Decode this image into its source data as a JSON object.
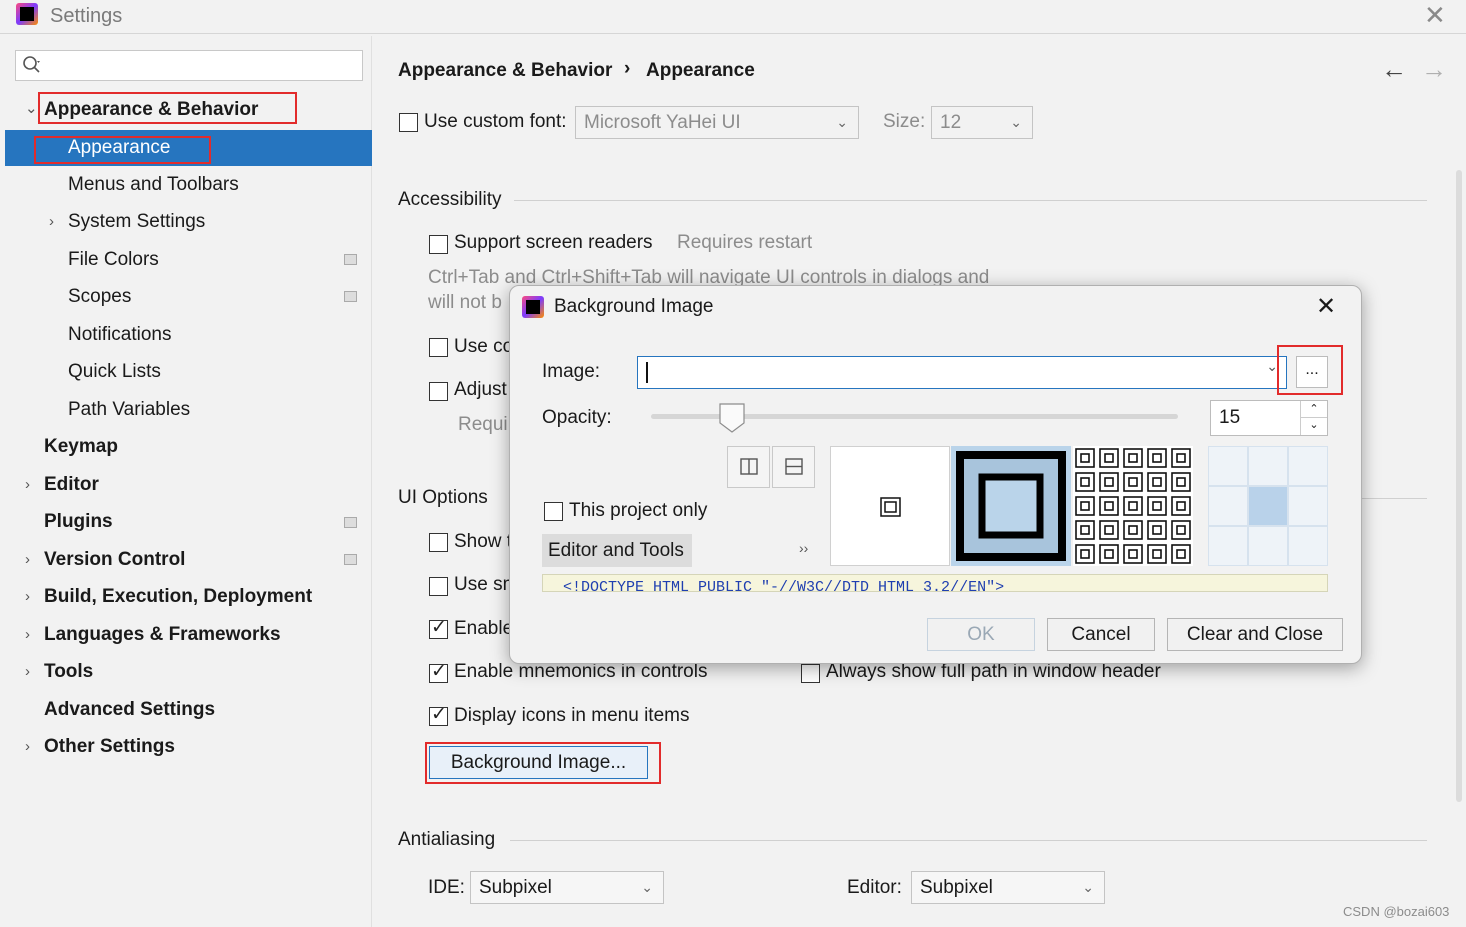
{
  "window": {
    "title": "Settings",
    "close_icon": "close-icon"
  },
  "sidebar": {
    "search_placeholder": "",
    "items": [
      {
        "label": "Appearance & Behavior",
        "level": 0,
        "expanded": true
      },
      {
        "label": "Appearance",
        "level": 1,
        "selected": true
      },
      {
        "label": "Menus and Toolbars",
        "level": 1
      },
      {
        "label": "System Settings",
        "level": 1,
        "expandable": true
      },
      {
        "label": "File Colors",
        "level": 1
      },
      {
        "label": "Scopes",
        "level": 1
      },
      {
        "label": "Notifications",
        "level": 1
      },
      {
        "label": "Quick Lists",
        "level": 1
      },
      {
        "label": "Path Variables",
        "level": 1
      },
      {
        "label": "Keymap",
        "level": 0
      },
      {
        "label": "Editor",
        "level": 0,
        "expandable": true
      },
      {
        "label": "Plugins",
        "level": 0
      },
      {
        "label": "Version Control",
        "level": 0,
        "expandable": true
      },
      {
        "label": "Build, Execution, Deployment",
        "level": 0,
        "expandable": true
      },
      {
        "label": "Languages & Frameworks",
        "level": 0,
        "expandable": true
      },
      {
        "label": "Tools",
        "level": 0,
        "expandable": true
      },
      {
        "label": "Advanced Settings",
        "level": 0
      },
      {
        "label": "Other Settings",
        "level": 0,
        "expandable": true
      }
    ]
  },
  "breadcrumb": {
    "parent": "Appearance & Behavior",
    "separator": "›",
    "current": "Appearance"
  },
  "font": {
    "use_custom_label": "Use custom font:",
    "font_value": "Microsoft YaHei UI",
    "size_label": "Size:",
    "size_value": "12"
  },
  "accessibility": {
    "heading": "Accessibility",
    "screen_readers_label": "Support screen readers",
    "requires_restart": "Requires restart",
    "desc_line1": "Ctrl+Tab and Ctrl+Shift+Tab will navigate UI controls in dialogs and",
    "desc_line2": "will not b",
    "use_co_label": "Use co",
    "adjust_label": "Adjust",
    "requi_label": "Requi"
  },
  "ui_options": {
    "heading": "UI Options",
    "show_label": "Show t",
    "use_sm_label": "Use sm",
    "enable_label": "Enable",
    "mnemonics_controls_label": "Enable mnemonics in controls",
    "full_path_label": "Always show full path in window header",
    "display_icons_label": "Display icons in menu items",
    "background_image_button": "Background Image..."
  },
  "antialiasing": {
    "heading": "Antialiasing",
    "ide_label": "IDE:",
    "ide_value": "Subpixel",
    "editor_label": "Editor:",
    "editor_value": "Subpixel"
  },
  "dialog": {
    "title": "Background Image",
    "image_label": "Image:",
    "image_value": "",
    "browse_label": "...",
    "opacity_label": "Opacity:",
    "opacity_value": "15",
    "opacity_slider_value": 15,
    "this_project_only_label": "This project only",
    "target_tab_label": "Editor and Tools",
    "more_label": "››",
    "code_preview": "<!DOCTYPE HTML PUBLIC \"-//W3C//DTD HTML 3.2//EN\">",
    "ok_label": "OK",
    "cancel_label": "Cancel",
    "clear_close_label": "Clear and Close"
  },
  "watermark": "CSDN @bozai603",
  "colors": {
    "selection": "#2675bf",
    "highlight_box": "#e22b2b",
    "focus": "#2675bf"
  }
}
